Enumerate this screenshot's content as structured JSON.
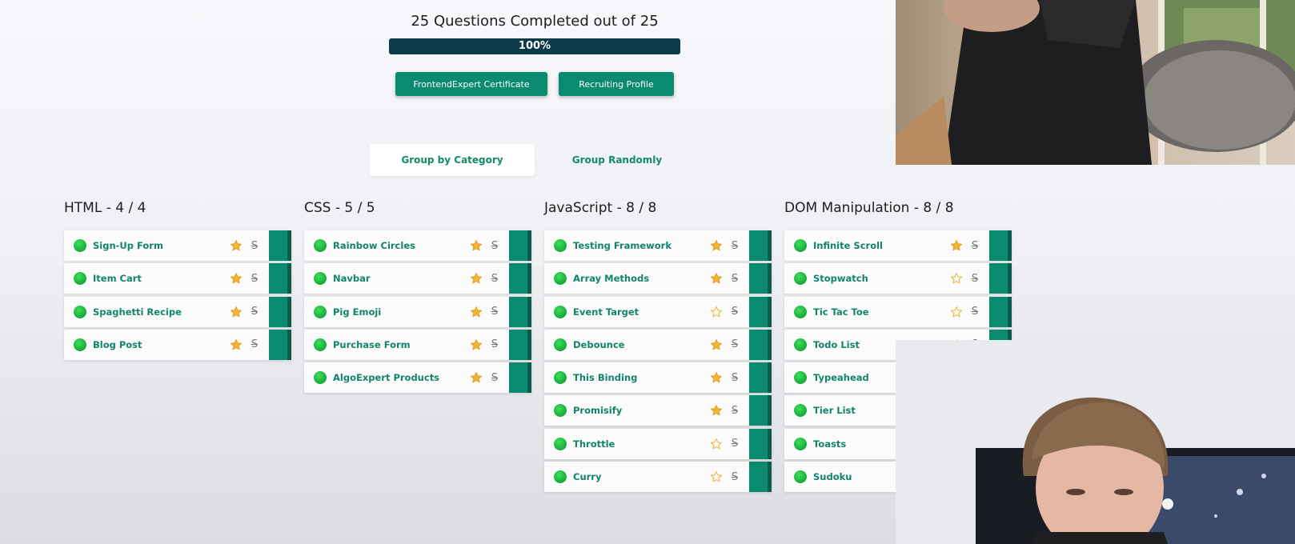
{
  "progress": {
    "title": "25 Questions Completed out of 25",
    "percent_label": "100%",
    "percent_value": 100
  },
  "buttons": {
    "certificate": "FrontendExpert Certificate",
    "recruiting": "Recruiting Profile"
  },
  "grouping": {
    "by_category": "Group by Category",
    "randomly": "Group Randomly",
    "active": "by_category"
  },
  "colors": {
    "accent": "#0a8a6e",
    "accent_dark": "#075d4a",
    "link": "#128469",
    "progress": "#0d3a4b",
    "star_filled": "#f4b537",
    "complete_dot": "#1fc047"
  },
  "categories": [
    {
      "title": "HTML - 4 / 4",
      "questions": [
        {
          "name": "Sign-Up Form",
          "starred": true
        },
        {
          "name": "Item Cart",
          "starred": true
        },
        {
          "name": "Spaghetti Recipe",
          "starred": true
        },
        {
          "name": "Blog Post",
          "starred": true
        }
      ]
    },
    {
      "title": "CSS - 5 / 5",
      "questions": [
        {
          "name": "Rainbow Circles",
          "starred": true
        },
        {
          "name": "Navbar",
          "starred": true
        },
        {
          "name": "Pig Emoji",
          "starred": true
        },
        {
          "name": "Purchase Form",
          "starred": true
        },
        {
          "name": "AlgoExpert Products",
          "starred": true
        }
      ]
    },
    {
      "title": "JavaScript - 8 / 8",
      "questions": [
        {
          "name": "Testing Framework",
          "starred": true
        },
        {
          "name": "Array Methods",
          "starred": true
        },
        {
          "name": "Event Target",
          "starred": false
        },
        {
          "name": "Debounce",
          "starred": true
        },
        {
          "name": "This Binding",
          "starred": true
        },
        {
          "name": "Promisify",
          "starred": true
        },
        {
          "name": "Throttle",
          "starred": false
        },
        {
          "name": "Curry",
          "starred": false
        }
      ]
    },
    {
      "title": "DOM Manipulation - 8 / 8",
      "questions": [
        {
          "name": "Infinite Scroll",
          "starred": true
        },
        {
          "name": "Stopwatch",
          "starred": false
        },
        {
          "name": "Tic Tac Toe",
          "starred": false
        },
        {
          "name": "Todo List",
          "starred": false
        },
        {
          "name": "Typeahead",
          "starred": false
        },
        {
          "name": "Tier List",
          "starred": false
        },
        {
          "name": "Toasts",
          "starred": false
        },
        {
          "name": "Sudoku",
          "starred": false
        }
      ]
    }
  ]
}
